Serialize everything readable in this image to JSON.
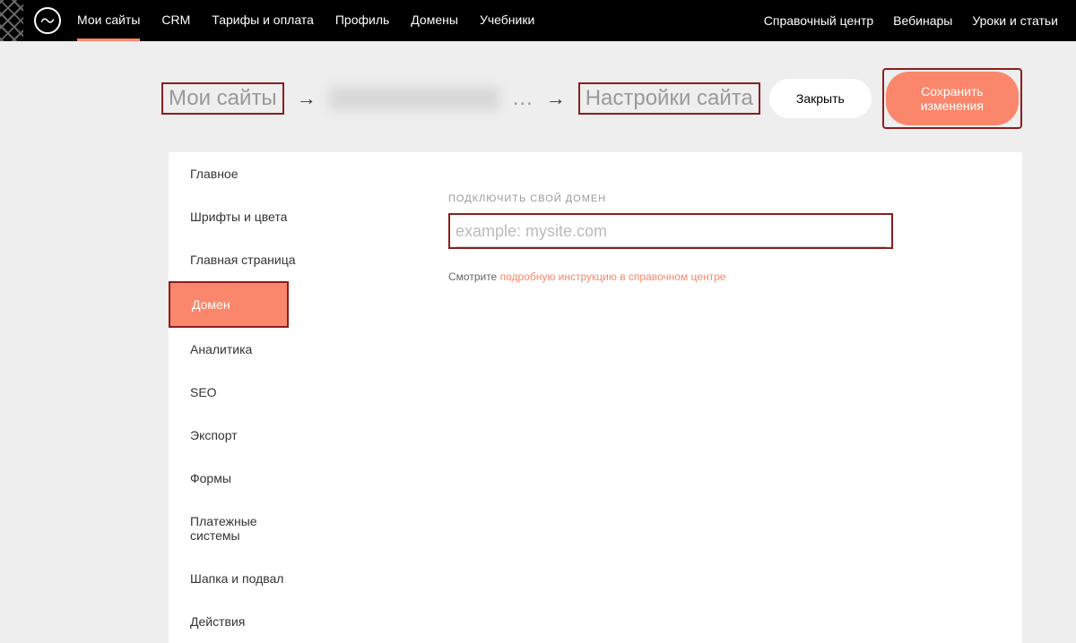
{
  "topnav": {
    "left": [
      {
        "label": "Мои сайты",
        "active": true
      },
      {
        "label": "CRM"
      },
      {
        "label": "Тарифы и оплата"
      },
      {
        "label": "Профиль"
      },
      {
        "label": "Домены"
      },
      {
        "label": "Учебники"
      }
    ],
    "right": [
      {
        "label": "Справочный центр"
      },
      {
        "label": "Вебинары"
      },
      {
        "label": "Уроки и статьи"
      }
    ]
  },
  "breadcrumb": {
    "first": "Мои сайты",
    "ellipsis": "…",
    "last": "Настройки сайта"
  },
  "actions": {
    "close": "Закрыть",
    "save": "Сохранить изменения"
  },
  "sidebar": {
    "items": [
      {
        "label": "Главное"
      },
      {
        "label": "Шрифты и цвета"
      },
      {
        "label": "Главная страница"
      },
      {
        "label": "Домен",
        "active": true,
        "highlight": true
      },
      {
        "label": "Аналитика"
      },
      {
        "label": "SEO"
      },
      {
        "label": "Экспорт"
      },
      {
        "label": "Формы"
      },
      {
        "label": "Платежные системы"
      },
      {
        "label": "Шапка и подвал"
      },
      {
        "label": "Действия"
      }
    ]
  },
  "domain": {
    "section_label": "ПОДКЛЮЧИТЬ СВОЙ ДОМЕН",
    "placeholder": "example: mysite.com",
    "hint_prefix": "Смотрите ",
    "hint_link": "подробную инструкцию в справочном центре"
  }
}
